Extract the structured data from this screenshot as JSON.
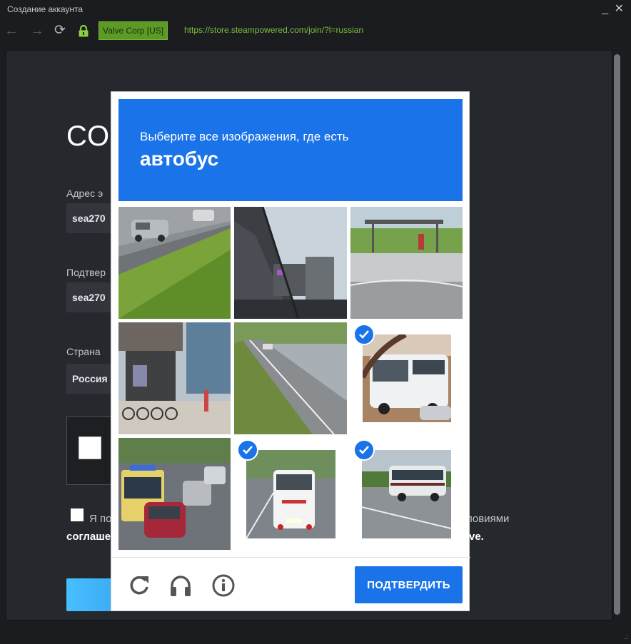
{
  "window": {
    "title": "Создание аккаунта",
    "minimize_glyph": "_",
    "close_glyph": "✕"
  },
  "navbar": {
    "back_icon": "arrow-left-icon",
    "forward_icon": "arrow-right-icon",
    "reload_icon": "reload-icon",
    "lock_icon": "lock-icon",
    "cert_label": "Valve Corp [US]",
    "url": "https://store.steampowered.com/join/?l=russian"
  },
  "page": {
    "heading": "СО",
    "email_label": "Адрес э",
    "email_value": "sea270",
    "confirm_label": "Подтвер",
    "confirm_value": "sea270",
    "country_label": "Страна",
    "country_value": "Россия",
    "agree_text_left": "Я по",
    "agree_text_right": "ловиями",
    "agree_link_left": "соглаше",
    "agree_link_right": "ve."
  },
  "recaptcha": {
    "instruction": "Выберите все изображения, где есть",
    "target": "автобус",
    "tiles": [
      {
        "name": "tile-1",
        "scene": "highway-cars",
        "selected": false
      },
      {
        "name": "tile-2",
        "scene": "overpass-road",
        "selected": false
      },
      {
        "name": "tile-3",
        "scene": "bus-stop-shelter",
        "selected": false
      },
      {
        "name": "tile-4",
        "scene": "street-bikes",
        "selected": false
      },
      {
        "name": "tile-5",
        "scene": "empty-road",
        "selected": false
      },
      {
        "name": "tile-6",
        "scene": "white-bus",
        "selected": true
      },
      {
        "name": "tile-7",
        "scene": "city-traffic-bus",
        "selected": false
      },
      {
        "name": "tile-8",
        "scene": "bus-rear",
        "selected": true
      },
      {
        "name": "tile-9",
        "scene": "coach-bus-highway",
        "selected": true
      }
    ],
    "reload_icon": "reload-icon",
    "audio_icon": "headphones-icon",
    "info_icon": "info-icon",
    "confirm_label": "ПОДТВЕРДИТЬ"
  },
  "colors": {
    "accent": "#1a73e8",
    "cert_bg": "#5c9a25",
    "url": "#7bbf3a",
    "page_bg": "#25282d"
  }
}
